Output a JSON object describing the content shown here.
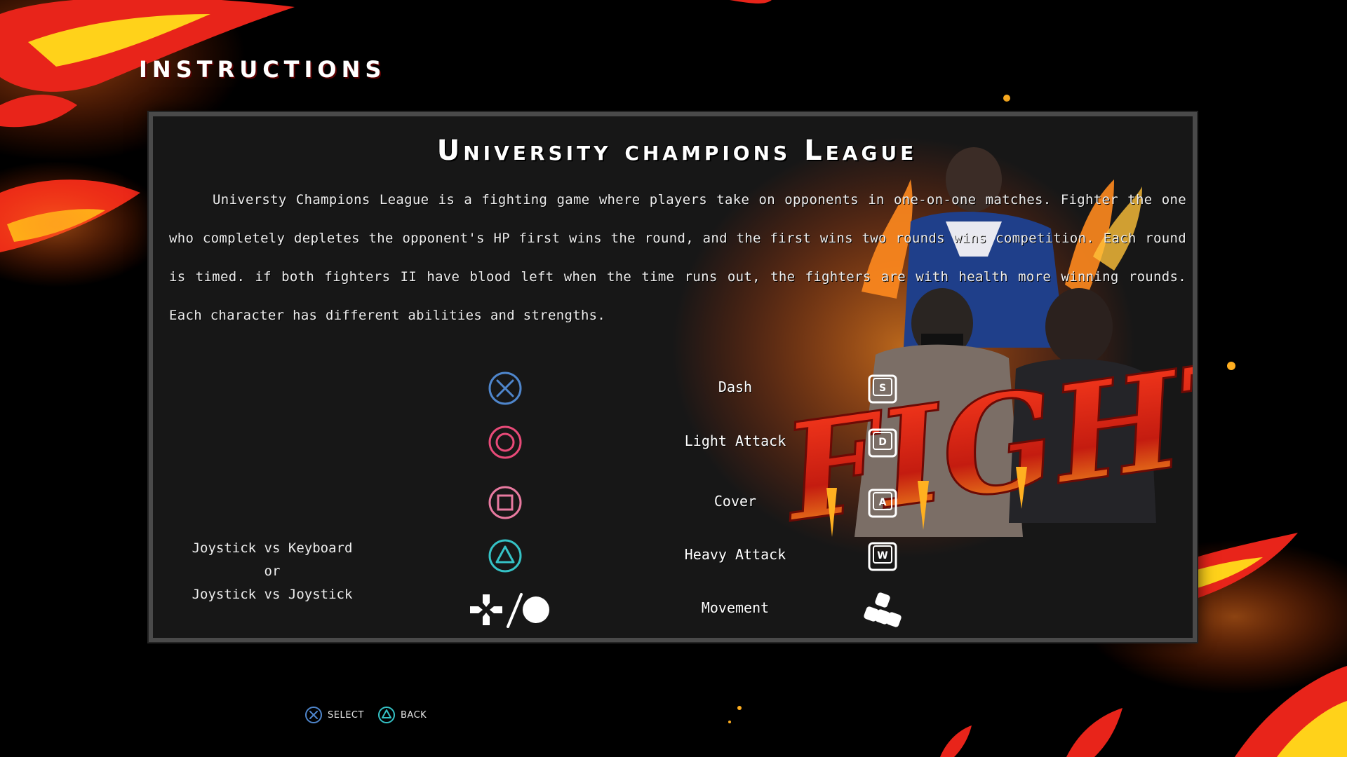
{
  "screen": {
    "title": "INSTRUCTIONS"
  },
  "panel": {
    "game_title": "University champions League",
    "description": "Universty Champions League is a fighting game where players take on opponents in one-on-one matches. Fighter the one who completely depletes the opponent's HP first wins the round, and the first wins two rounds wins competition. Each round is timed. if both fighters II have blood left when the time runs out, the fighters are with health more winning rounds. Each character has different abilities and strengths.",
    "mode_label": {
      "line1": "Joystick vs Keyboard",
      "line2": "or",
      "line3": "Joystick vs Joystick"
    },
    "art": {
      "fight_text": "FIGHT"
    },
    "controls": [
      {
        "action": "Dash",
        "pad_icon": "cross-icon",
        "key": "S",
        "color": "#4f86cc"
      },
      {
        "action": "Light Attack",
        "pad_icon": "circle-icon",
        "key": "D",
        "color": "#e84a78"
      },
      {
        "action": "Cover",
        "pad_icon": "square-icon",
        "key": "A",
        "color": "#e87aa0"
      },
      {
        "action": "Heavy Attack",
        "pad_icon": "triangle-icon",
        "key": "W",
        "color": "#35c2c6"
      },
      {
        "action": "Movement",
        "pad_icon": "dpad-slash-stick-icon",
        "key": "wasd-keys-icon",
        "color": "#ffffff"
      }
    ]
  },
  "footer": {
    "select_label": "SELECT",
    "back_label": "BACK"
  },
  "colors": {
    "flame_red": "#e8241a",
    "flame_yellow": "#ffd21a",
    "panel_bg": "#171717",
    "panel_border": "#4a4a4a"
  }
}
